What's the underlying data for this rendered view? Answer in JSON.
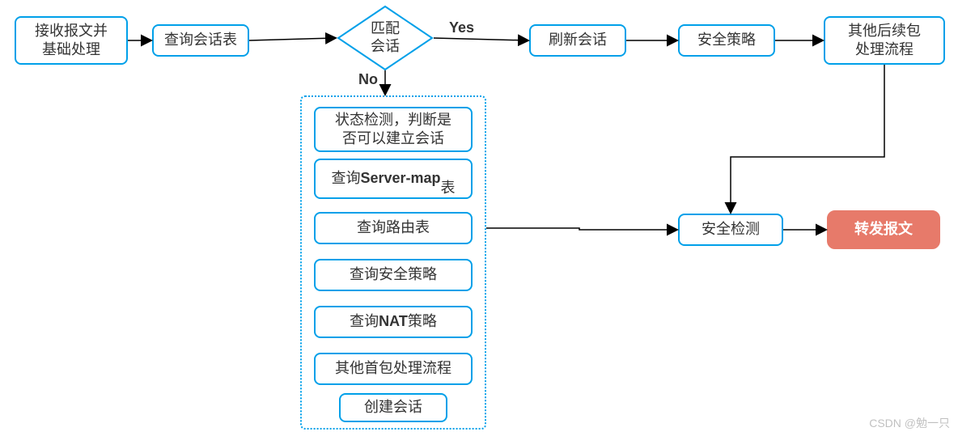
{
  "top": {
    "receive": "接收报文并\n基础处理",
    "query_session": "查询会话表",
    "match_session": "匹配\n会话",
    "yes": "Yes",
    "no": "No",
    "refresh": "刷新会话",
    "sec_policy": "安全策略",
    "other_followup": "其他后续包\n处理流程"
  },
  "sub": {
    "state_check": "状态检测，判断是\n否可以建立会话",
    "server_map": "查询Server-map\n表",
    "route": "查询路由表",
    "sec_policy": "查询安全策略",
    "nat": "查询NAT策略",
    "other_first": "其他首包处理流程",
    "create": "创建会话"
  },
  "right": {
    "sec_check": "安全检测",
    "forward": "转发报文"
  },
  "watermark": "CSDN @勉一只"
}
